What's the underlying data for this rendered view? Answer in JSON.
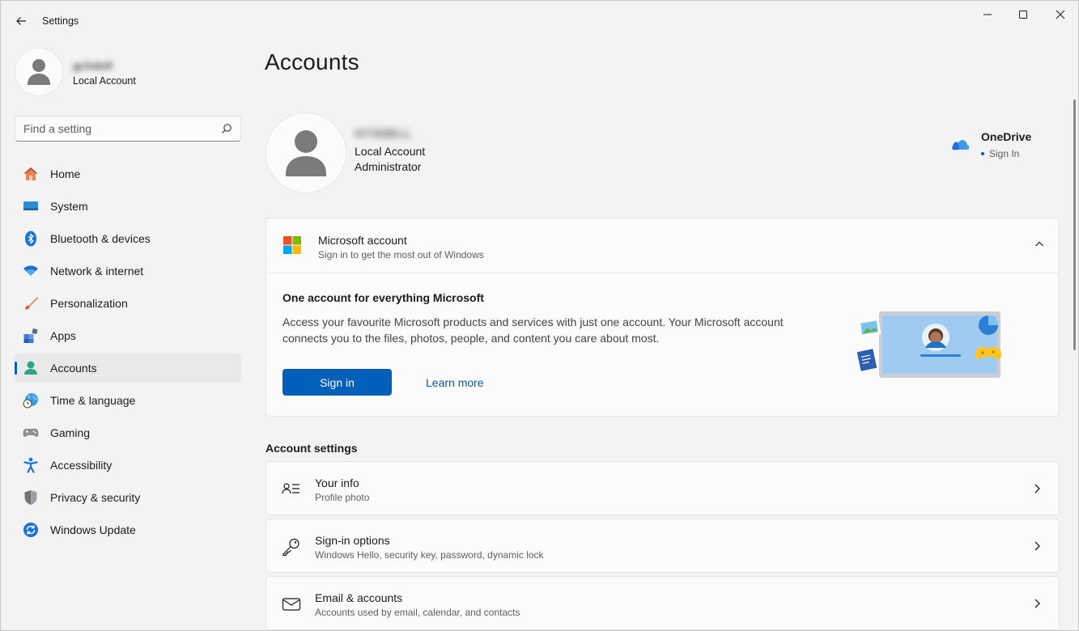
{
  "window": {
    "title": "Settings"
  },
  "profile": {
    "name": "gchdell",
    "type": "Local Account"
  },
  "search": {
    "placeholder": "Find a setting"
  },
  "nav": {
    "items": [
      {
        "label": "Home",
        "icon": "home-icon"
      },
      {
        "label": "System",
        "icon": "system-icon"
      },
      {
        "label": "Bluetooth & devices",
        "icon": "bluetooth-icon"
      },
      {
        "label": "Network & internet",
        "icon": "network-icon"
      },
      {
        "label": "Personalization",
        "icon": "brush-icon"
      },
      {
        "label": "Apps",
        "icon": "apps-icon"
      },
      {
        "label": "Accounts",
        "icon": "accounts-icon",
        "active": true
      },
      {
        "label": "Time & language",
        "icon": "time-language-icon"
      },
      {
        "label": "Gaming",
        "icon": "gaming-icon"
      },
      {
        "label": "Accessibility",
        "icon": "accessibility-icon"
      },
      {
        "label": "Privacy & security",
        "icon": "shield-icon"
      },
      {
        "label": "Windows Update",
        "icon": "update-icon"
      }
    ]
  },
  "main": {
    "title": "Accounts",
    "user": {
      "name": "GTXDELL",
      "line1": "Local Account",
      "line2": "Administrator"
    },
    "onedrive": {
      "title": "OneDrive",
      "status": "Sign In"
    },
    "ms_account": {
      "title": "Microsoft account",
      "subtitle": "Sign in to get the most out of Windows",
      "body_title": "One account for everything Microsoft",
      "body_text": "Access your favourite Microsoft products and services with just one account. Your Microsoft account connects you to the files, photos, people, and content you care about most.",
      "sign_in_label": "Sign in",
      "learn_more_label": "Learn more"
    },
    "section_heading": "Account settings",
    "rows": [
      {
        "title": "Your info",
        "subtitle": "Profile photo",
        "icon": "person-info-icon"
      },
      {
        "title": "Sign-in options",
        "subtitle": "Windows Hello, security key, password, dynamic lock",
        "icon": "key-icon"
      },
      {
        "title": "Email & accounts",
        "subtitle": "Accounts used by email, calendar, and contacts",
        "icon": "mail-icon"
      }
    ]
  },
  "colors": {
    "accent": "#005fb8",
    "background": "#f3f3f3",
    "card": "#fbfbfb"
  }
}
